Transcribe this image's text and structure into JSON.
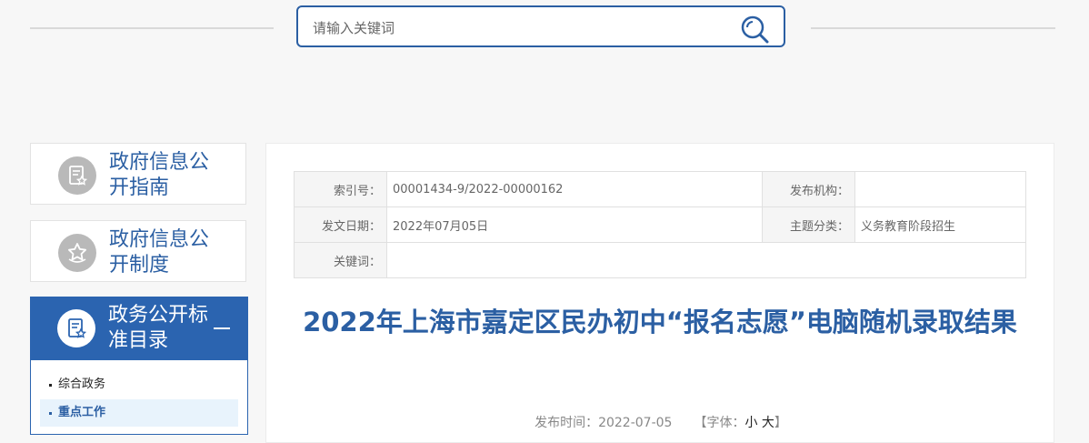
{
  "search": {
    "placeholder": "请输入关键词",
    "icon": "search-icon"
  },
  "sidebar": {
    "cards": [
      {
        "label": "政府信息公开指南",
        "icon": "document-star-icon"
      },
      {
        "label": "政府信息公开制度",
        "icon": "star-badge-icon"
      }
    ],
    "active": {
      "label": "政务公开标准目录",
      "icon": "document-star-icon",
      "toggle": "collapse"
    },
    "submenu": [
      {
        "label": "综合政务",
        "selected": false
      },
      {
        "label": "重点工作",
        "selected": true
      }
    ]
  },
  "meta": {
    "index_label": "索引号：",
    "index_value": "00001434-9/2022-00000162",
    "publisher_label": "发布机构：",
    "publisher_value": "",
    "date_label": "发文日期：",
    "date_value": "2022年07月05日",
    "topic_label": "主题分类：",
    "topic_value": "义务教育阶段招生",
    "keyword_label": "关键词：",
    "keyword_value": ""
  },
  "article": {
    "title": "2022年上海市嘉定区民办初中“报名志愿”电脑随机录取结果",
    "pub_time": "发布时间：2022-07-05",
    "font_open": "【字体：",
    "font_small": "小",
    "font_large": "大",
    "font_close": "】"
  },
  "colors": {
    "accent": "#2b5fa3",
    "active_bg": "#2b64b0",
    "selected_bg": "#e8f3fc"
  }
}
